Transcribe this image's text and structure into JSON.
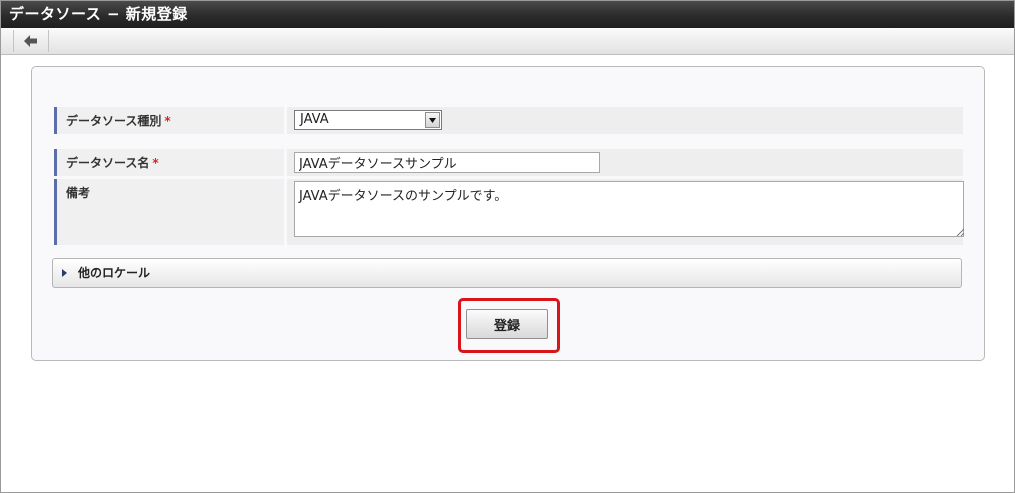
{
  "window": {
    "title": "データソース − 新規登録"
  },
  "toolbar": {
    "back_icon": "arrow-left-icon"
  },
  "form": {
    "type_field": {
      "label": "データソース種別",
      "required_mark": "*",
      "selected": "JAVA"
    },
    "name_field": {
      "label": "データソース名",
      "required_mark": "*",
      "value": "JAVAデータソースサンプル"
    },
    "note_field": {
      "label": "備考",
      "value": "JAVAデータソースのサンプルです。"
    }
  },
  "locale_section": {
    "label": "他のロケール",
    "icon": "triangle-right-icon"
  },
  "actions": {
    "register_label": "登録"
  },
  "colors": {
    "highlight": "#d9141b",
    "label_accent": "#5a6ea8",
    "required": "#dd2222"
  }
}
